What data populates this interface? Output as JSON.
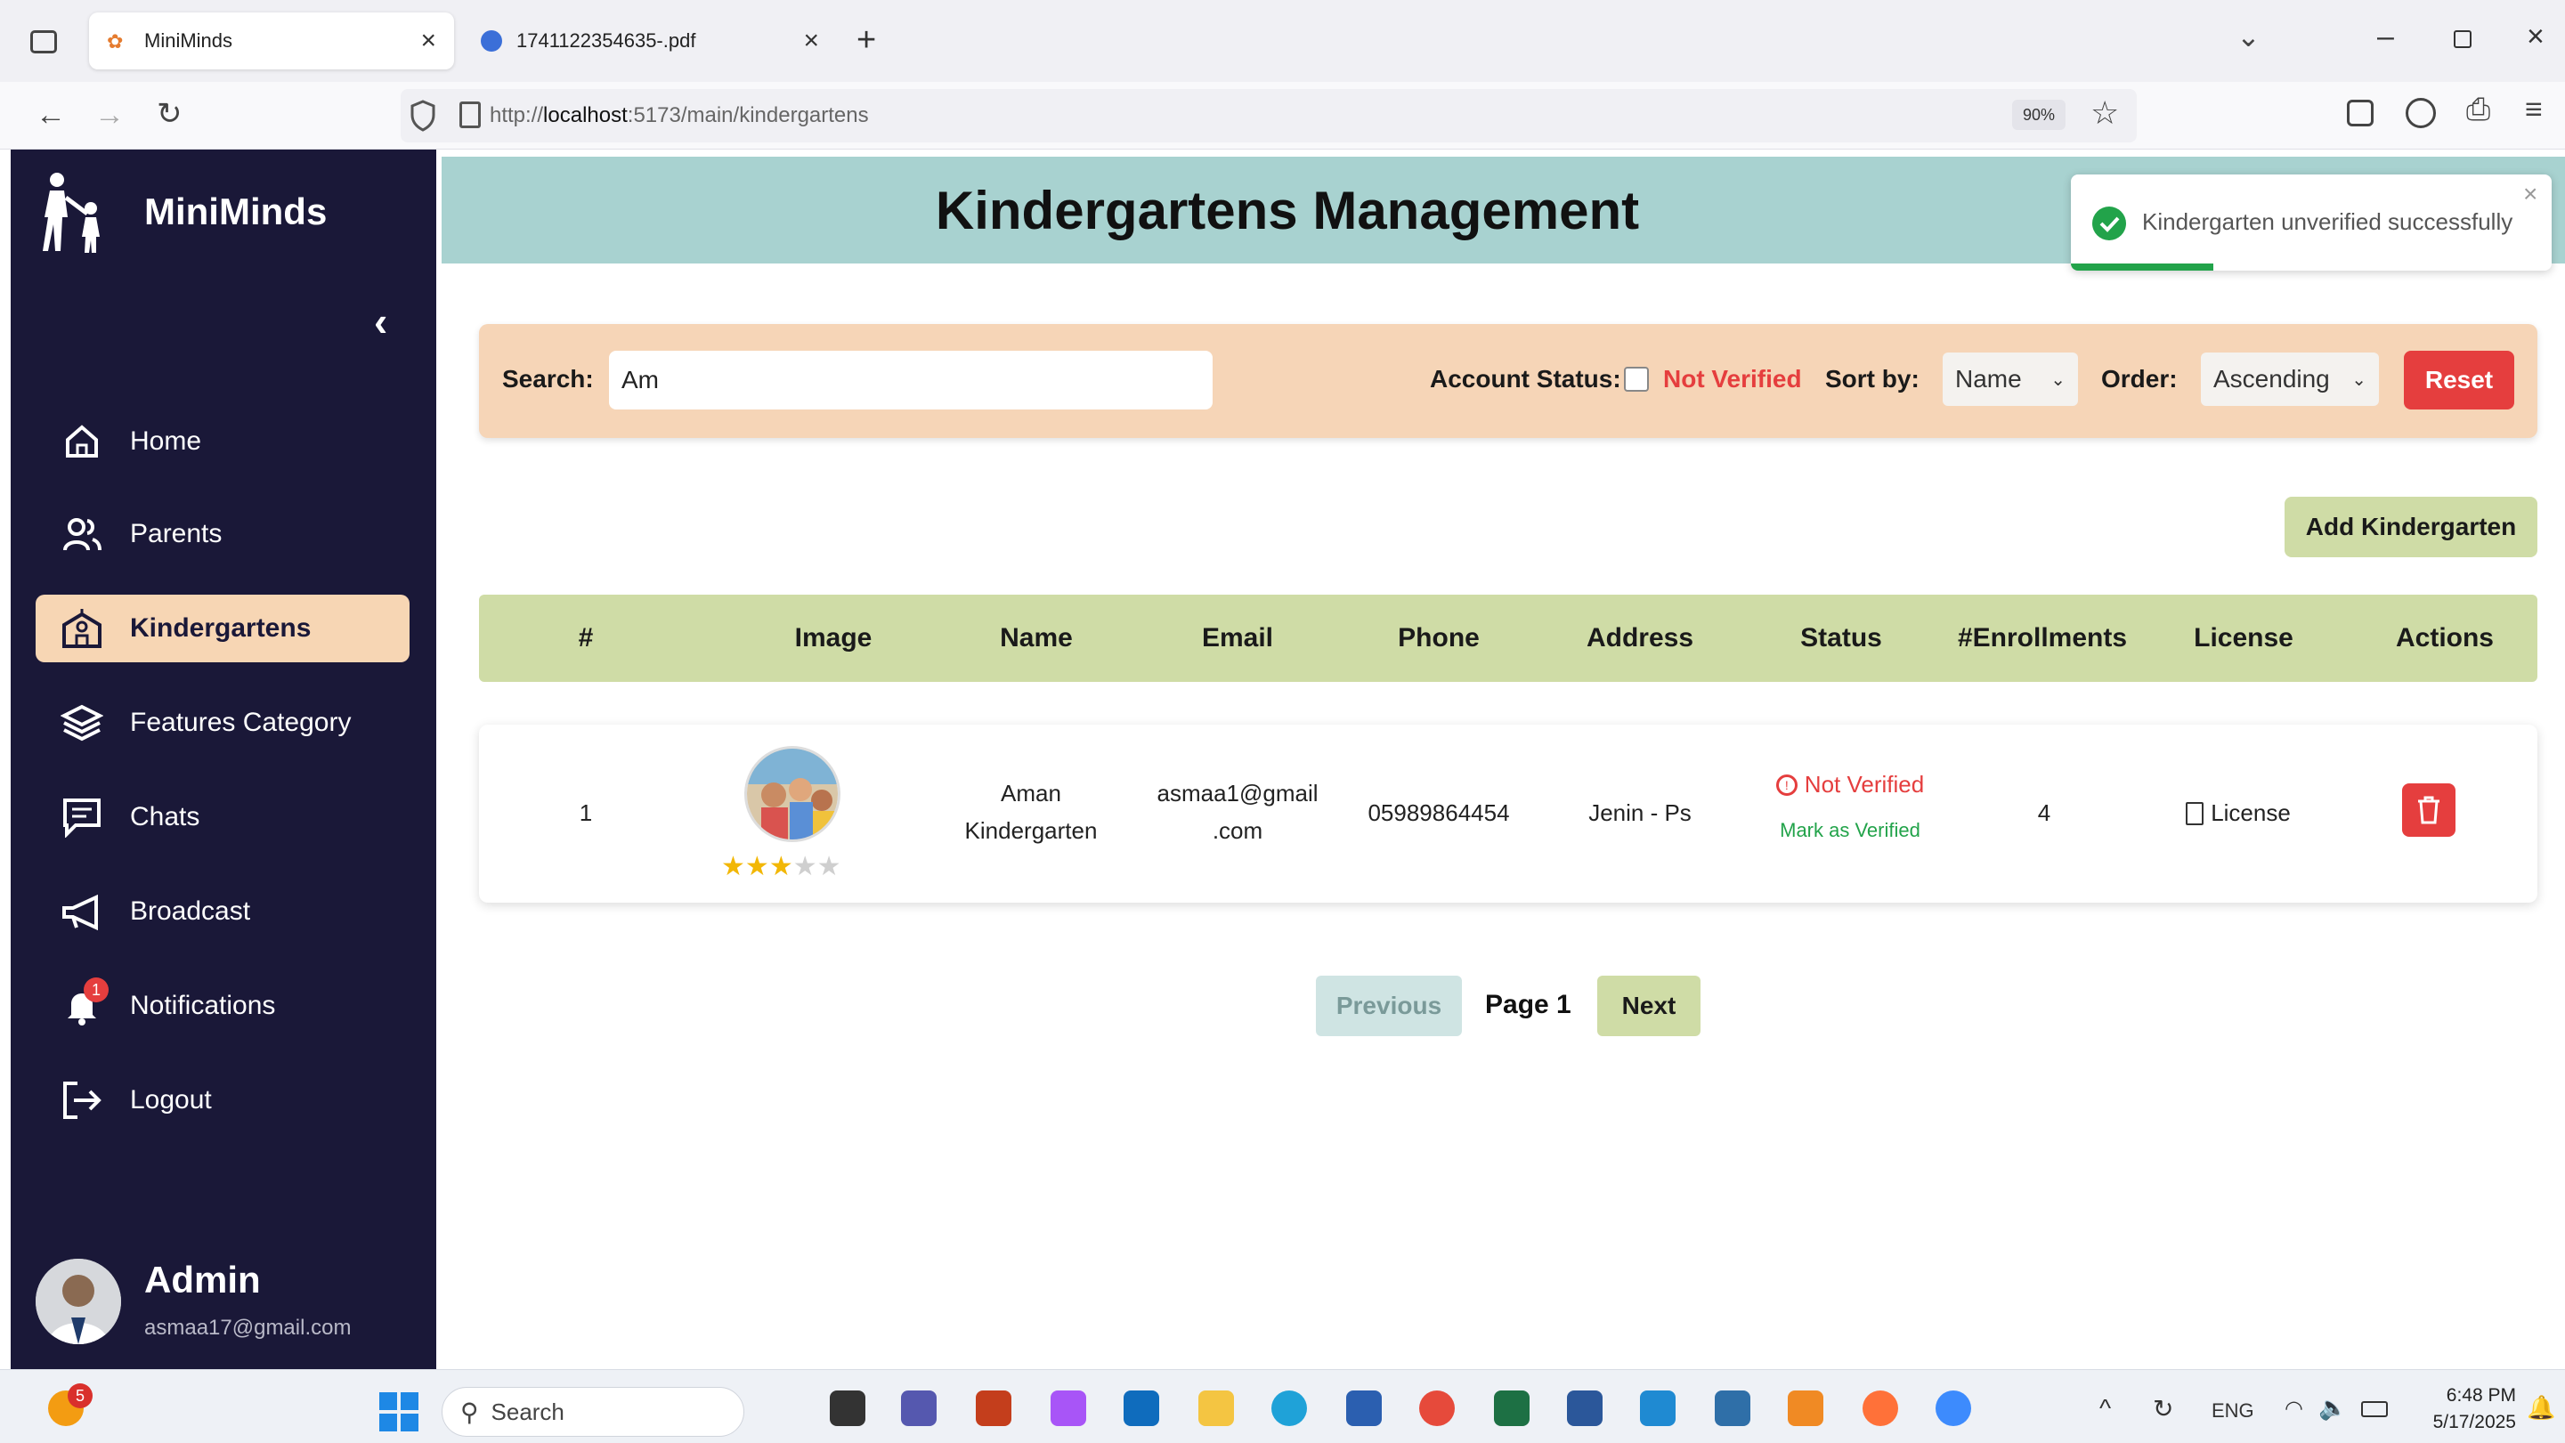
{
  "browser": {
    "tabs": [
      {
        "label": "MiniMinds",
        "active": true
      },
      {
        "label": "1741122354635-.pdf",
        "active": false
      }
    ],
    "url_prefix": "http://",
    "url_host": "localhost",
    "url_path": ":5173/main/kindergartens",
    "zoom": "90%"
  },
  "sidebar": {
    "brand": "MiniMinds",
    "items": [
      {
        "label": "Home",
        "icon": "home-icon"
      },
      {
        "label": "Parents",
        "icon": "users-icon"
      },
      {
        "label": "Kindergartens",
        "icon": "school-icon",
        "active": true
      },
      {
        "label": "Features Category",
        "icon": "layers-icon"
      },
      {
        "label": "Chats",
        "icon": "chat-icon"
      },
      {
        "label": "Broadcast",
        "icon": "megaphone-icon"
      },
      {
        "label": "Notifications",
        "icon": "bell-icon",
        "badge": "1"
      },
      {
        "label": "Logout",
        "icon": "logout-icon"
      }
    ],
    "user": {
      "name": "Admin",
      "email": "asmaa17@gmail.com"
    }
  },
  "header": {
    "title": "Kindergartens Management"
  },
  "toast": {
    "message": "Kindergarten unverified successfully",
    "progress": 0.3
  },
  "filters": {
    "search_label": "Search:",
    "search_value": "Am",
    "account_status_label": "Account Status:",
    "not_verified_label": "Not Verified",
    "sort_label": "Sort by:",
    "sort_value": "Name",
    "order_label": "Order:",
    "order_value": "Ascending",
    "reset_label": "Reset"
  },
  "add_button": "Add Kindergarten",
  "table": {
    "columns": [
      "#",
      "Image",
      "Name",
      "Email",
      "Phone",
      "Address",
      "Status",
      "#Enrollments",
      "License",
      "Actions"
    ],
    "rows": [
      {
        "index": "1",
        "rating": 3,
        "rating_max": 5,
        "name_line1": "Aman",
        "name_line2": "Kindergarten",
        "email_line1": "asmaa1@gmail",
        "email_line2": ".com",
        "phone": "05989864454",
        "address": "Jenin - Ps",
        "status": "Not Verified",
        "status_action": "Mark as Verified",
        "enrollments": "4",
        "license": "License"
      }
    ]
  },
  "pagination": {
    "previous": "Previous",
    "page": "Page 1",
    "next": "Next"
  },
  "taskbar": {
    "search_placeholder": "Search",
    "notification_count": "5",
    "lang": "ENG",
    "time": "6:48 PM",
    "date": "5/17/2025"
  },
  "colors": {
    "sidebar_bg": "#1a1838",
    "active_item": "#f7d6b4",
    "header_bg": "#a8d2d0",
    "filter_bg": "#f6d5b7",
    "table_head": "#cfdca6",
    "danger": "#e53e3e",
    "success": "#22a34a"
  }
}
